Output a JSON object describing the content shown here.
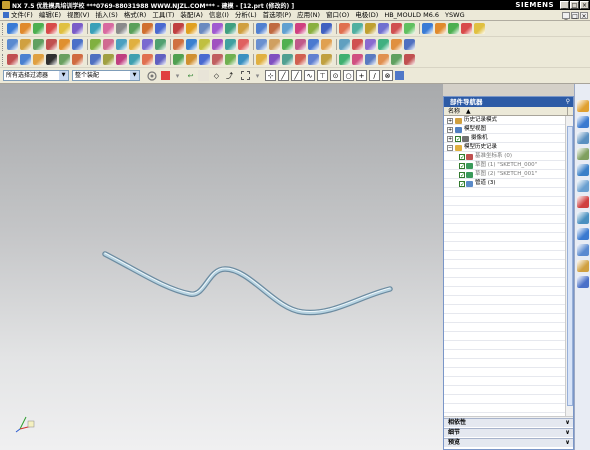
{
  "titlebar": {
    "title": "NX 7.5 优胜模具培训学校 ***0769-88031988 WWW.NJZL.COM*** - 建模 - [12.prt (修改的) ]",
    "brand": "SIEMENS",
    "buttons": [
      "_",
      "□",
      "×"
    ]
  },
  "menu": {
    "items": [
      "文件(F)",
      "编辑(E)",
      "视图(V)",
      "插入(S)",
      "格式(R)",
      "工具(T)",
      "装配(A)",
      "信息(I)",
      "分析(L)",
      "首选项(P)",
      "应用(N)",
      "窗口(O)",
      "电极(D)",
      "HB_MOULD M6.6",
      "YSWG"
    ],
    "window_controls": [
      "_",
      "□",
      "×"
    ]
  },
  "filterbar": {
    "type_filter": "所有选择过滤器",
    "scope_filter": "整个装配"
  },
  "nav_panel": {
    "title": "部件导航器",
    "column_name": "名称",
    "column_sort": "▲",
    "tree": [
      {
        "indent": 0,
        "expander": "+",
        "checkbox": "",
        "icon": "clock",
        "label": "历史记录模式",
        "dim": false
      },
      {
        "indent": 0,
        "expander": "+",
        "checkbox": "",
        "icon": "views",
        "label": "模型视图",
        "dim": false
      },
      {
        "indent": 0,
        "expander": "+",
        "checkbox": "✓",
        "icon": "camera",
        "label": "摄像机",
        "dim": false
      },
      {
        "indent": 0,
        "expander": "−",
        "checkbox": "",
        "icon": "folder",
        "label": "模型历史记录",
        "dim": false
      },
      {
        "indent": 1,
        "expander": "",
        "checkbox": "✓",
        "icon": "datum",
        "label": "基准坐标系 (0)",
        "dim": true
      },
      {
        "indent": 1,
        "expander": "",
        "checkbox": "✓",
        "icon": "sketch",
        "label": "草图 (1) \"SKETCH_000\"",
        "dim": true
      },
      {
        "indent": 1,
        "expander": "",
        "checkbox": "✓",
        "icon": "sketch",
        "label": "草图 (2) \"SKETCH_001\"",
        "dim": true
      },
      {
        "indent": 1,
        "expander": "",
        "checkbox": "✓",
        "icon": "tube",
        "label": "管道 (3)",
        "dim": false
      }
    ],
    "sections": [
      {
        "label": "相依性"
      },
      {
        "label": "细节"
      },
      {
        "label": "预览"
      }
    ]
  },
  "colors": {
    "tube": "#8fb3c7",
    "panel_title": "#2d5ba6",
    "accent_check": "#1a8c1a"
  },
  "icons": {
    "triad": "csys-triad-icon"
  }
}
